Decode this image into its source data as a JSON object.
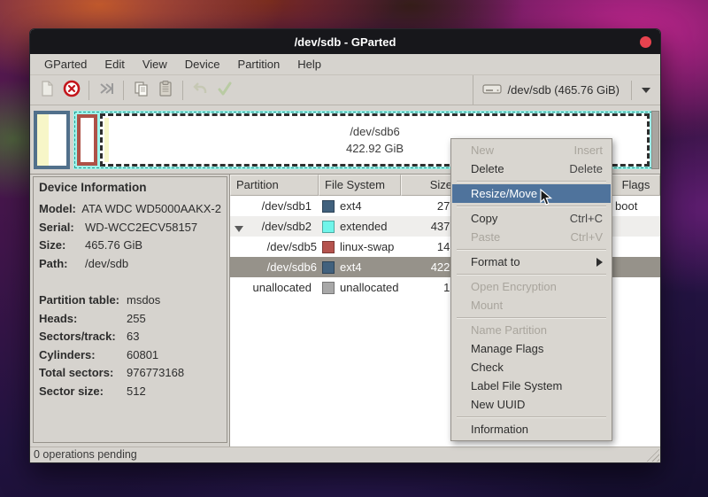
{
  "colors": {
    "menu_highlight": "#4f739c",
    "selected_row": "#96928a",
    "extended_cyan": "#9ef5ec",
    "ext4_swatch": "#41617d",
    "swap_swatch": "#b5534e",
    "unallocated_swatch": "#a8a8a8",
    "titlebar_bg": "#17171b",
    "close_button": "#e8434f"
  },
  "titlebar": {
    "title": "/dev/sdb - GParted"
  },
  "menubar": {
    "items": [
      {
        "label": "GParted"
      },
      {
        "label": "Edit"
      },
      {
        "label": "View"
      },
      {
        "label": "Device"
      },
      {
        "label": "Partition"
      },
      {
        "label": "Help"
      }
    ]
  },
  "toolbar": {
    "device_selector": "/dev/sdb  (465.76 GiB)"
  },
  "diskbar": {
    "sdb6_name": "/dev/sdb6",
    "sdb6_size": "422.92 GiB"
  },
  "device_info": {
    "title": "Device Information",
    "rows1": [
      {
        "label": "Model:",
        "value": "ATA WDC WD5000AAKX-2"
      },
      {
        "label": "Serial:",
        "value": "WD-WCC2ECV58157"
      },
      {
        "label": "Size:",
        "value": "465.76 GiB"
      },
      {
        "label": "Path:",
        "value": "/dev/sdb"
      }
    ],
    "rows2": [
      {
        "label": "Partition table:",
        "value": "msdos"
      },
      {
        "label": "Heads:",
        "value": "255"
      },
      {
        "label": "Sectors/track:",
        "value": "63"
      },
      {
        "label": "Cylinders:",
        "value": "60801"
      },
      {
        "label": "Total sectors:",
        "value": "976773168"
      },
      {
        "label": "Sector size:",
        "value": "512"
      }
    ]
  },
  "table": {
    "headers": {
      "partition": "Partition",
      "file_system": "File System",
      "size": "Size",
      "flags": "Flags"
    },
    "rows": [
      {
        "partition": "/dev/sdb1",
        "file_system": "ext4",
        "size": "27.",
        "flags": "boot"
      },
      {
        "partition": "/dev/sdb2",
        "file_system": "extended",
        "size": "437.",
        "flags": ""
      },
      {
        "partition": "/dev/sdb5",
        "file_system": "linux-swap",
        "size": "14.",
        "flags": ""
      },
      {
        "partition": "/dev/sdb6",
        "file_system": "ext4",
        "size": "422.",
        "flags": ""
      },
      {
        "partition": "unallocated",
        "file_system": "unallocated",
        "size": "1.",
        "flags": ""
      }
    ]
  },
  "context_menu": {
    "items": [
      {
        "label": "New",
        "accel": "Insert",
        "enabled": false
      },
      {
        "label": "Delete",
        "accel": "Delete",
        "enabled": true
      },
      {
        "label": "Resize/Move",
        "accel": "",
        "enabled": true,
        "highlighted": true
      },
      {
        "label": "Copy",
        "accel": "Ctrl+C",
        "enabled": true
      },
      {
        "label": "Paste",
        "accel": "Ctrl+V",
        "enabled": false
      },
      {
        "label": "Format to",
        "accel": "",
        "enabled": true,
        "submenu": true
      },
      {
        "label": "Open Encryption",
        "accel": "",
        "enabled": false
      },
      {
        "label": "Mount",
        "accel": "",
        "enabled": false
      },
      {
        "label": "Name Partition",
        "accel": "",
        "enabled": false
      },
      {
        "label": "Manage Flags",
        "accel": "",
        "enabled": true
      },
      {
        "label": "Check",
        "accel": "",
        "enabled": true
      },
      {
        "label": "Label File System",
        "accel": "",
        "enabled": true
      },
      {
        "label": "New UUID",
        "accel": "",
        "enabled": true
      },
      {
        "label": "Information",
        "accel": "",
        "enabled": true
      }
    ]
  },
  "statusbar": {
    "text": "0 operations pending"
  }
}
